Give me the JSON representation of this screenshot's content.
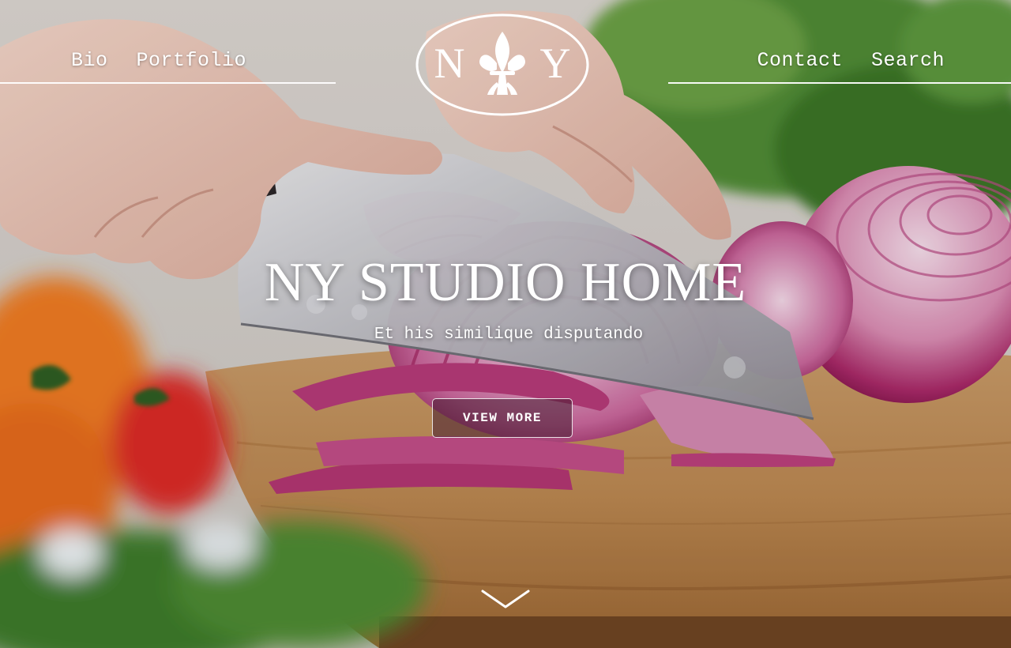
{
  "nav": {
    "left": [
      "Bio",
      "Portfolio"
    ],
    "right": [
      "Contact",
      "Search"
    ]
  },
  "logo": {
    "letters_left": "N",
    "letters_right": "Y",
    "icon": "fleur-de-lis-icon"
  },
  "hero": {
    "title": "NY STUDIO HOME",
    "subtitle": "Et his similique disputando",
    "cta_label": "VIEW MORE"
  },
  "icons": {
    "scroll": "chevron-down-icon"
  },
  "colors": {
    "text": "#ffffff",
    "onion": "#a0245e",
    "board": "#b07a45",
    "greens": "#3e7a2a",
    "button_bg": "#5a2a45"
  }
}
